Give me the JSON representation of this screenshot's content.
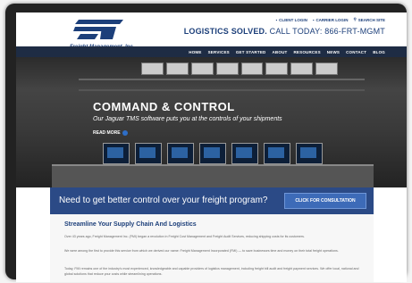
{
  "header": {
    "brand": "Freight Management, Inc.",
    "utility_links": [
      "CLIENT LOGIN",
      "CARRIER LOGIN",
      "SEARCH SITE"
    ],
    "tagline_bold": "LOGISTICS SOLVED.",
    "tagline_rest": " CALL TODAY: 866-FRT-MGMT",
    "nav": [
      "HOME",
      "SERVICES",
      "GET STARTED",
      "ABOUT",
      "RESOURCES",
      "NEWS",
      "CONTACT",
      "BLOG"
    ]
  },
  "hero": {
    "title": "COMMAND & CONTROL",
    "subtitle": "Our Jaguar TMS software puts you at the controls of your shipments",
    "more": "READ MORE"
  },
  "banner": {
    "text": "Need to get better control over your freight program?",
    "cta": "CLICK FOR CONSULTATION"
  },
  "content": {
    "heading": "Streamline Your Supply Chain And Logistics",
    "p1": "Over 43 years ago, Freight Management Inc. (FMI) began a revolution in Freight Cost Management and Freight Audit Services, reducing shipping costs for its customers.",
    "p2": "We were among the first to provide this service from which we derived our name: Freight Management Incorporated (FMI) — to save businesses time and money on their total freight operations.",
    "p3": "Today, FMI remains one of the industry's most experienced, knowledgeable and capable providers of logistics management, including freight bill audit and freight payment services. We offer local, national and global solutions that reduce your costs while streamlining operations."
  },
  "colors": {
    "brand": "#1c3f7a",
    "nav": "#1e2c44",
    "banner": "#2b4a86"
  },
  "icons": [
    "lock-icon",
    "lock-icon",
    "search-icon",
    "arrow-right-icon"
  ]
}
